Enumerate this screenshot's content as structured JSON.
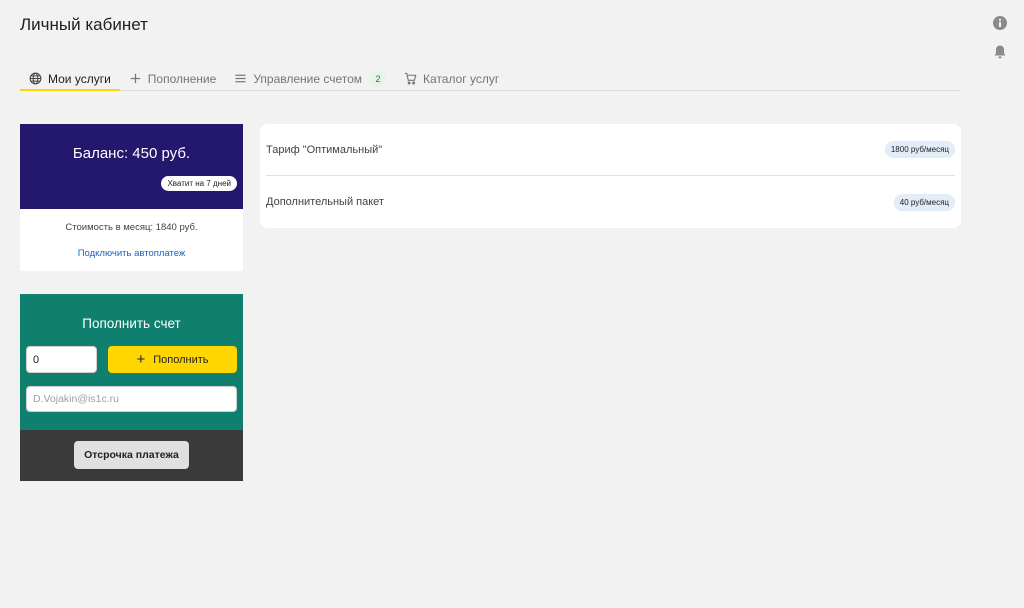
{
  "page": {
    "title": "Личный кабинет"
  },
  "colors": {
    "accent": "#ffd600",
    "balance_bg": "#23176e",
    "topup_bg": "#0f7f6e",
    "footer_bg": "#3a3a3a",
    "link": "#1565c0"
  },
  "side_icons": [
    {
      "name": "info-icon"
    },
    {
      "name": "bell-icon"
    }
  ],
  "tabs": [
    {
      "label": "Мои услуги",
      "icon": "globe-icon",
      "active": true
    },
    {
      "label": "Пополнение",
      "icon": "plus-icon",
      "active": false
    },
    {
      "label": "Управление счетом",
      "icon": "menu-icon",
      "badge": "2",
      "active": false
    },
    {
      "label": "Каталог услуг",
      "icon": "cart-icon",
      "active": false
    }
  ],
  "balance": {
    "title": "Баланс: 450 руб.",
    "days_left": "Хватит на 7 дней",
    "monthly_cost": "Стоимость в месяц: 1840 руб.",
    "autopay_link": "Подключить автоплатеж"
  },
  "topup": {
    "title": "Пополнить счет",
    "amount_value": "0",
    "button_label": "Пополнить",
    "email_placeholder": "D.Vojakin@is1c.ru",
    "defer_label": "Отсрочка платежа"
  },
  "services": [
    {
      "name": "Тариф \"Оптимальный\"",
      "price": "1800 руб/месяц"
    },
    {
      "name": "Дополнительный пакет",
      "price": "40 руб/месяц"
    }
  ]
}
